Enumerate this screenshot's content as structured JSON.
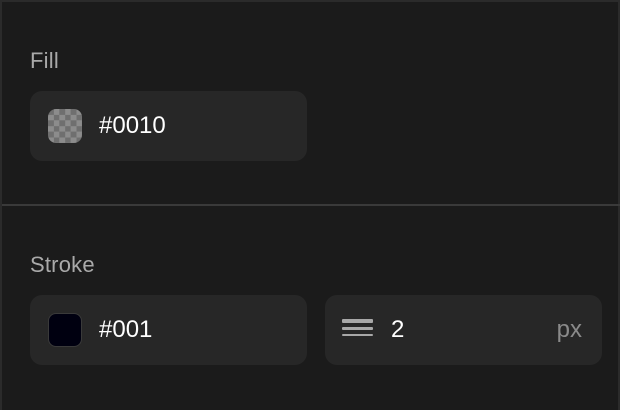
{
  "fill": {
    "title": "Fill",
    "color_value": "#0010",
    "swatch_type": "transparent-checker"
  },
  "stroke": {
    "title": "Stroke",
    "color_value": "#001",
    "swatch_color": "#000010",
    "width_icon": "stroke-width-icon",
    "width_value": "2",
    "width_unit": "px"
  }
}
